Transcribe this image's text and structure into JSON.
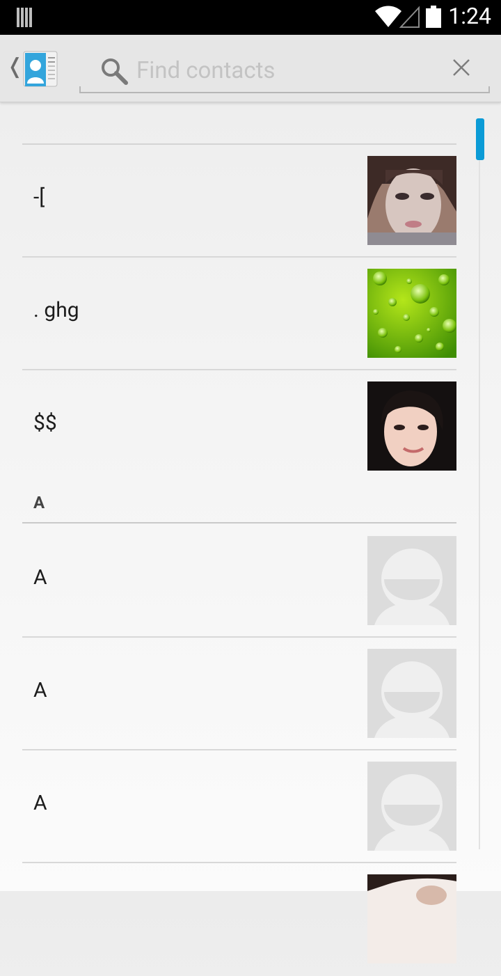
{
  "status_bar": {
    "time": "1:24"
  },
  "action_bar": {
    "search": {
      "placeholder": "Find contacts",
      "value": ""
    }
  },
  "contacts": {
    "rows": [
      {
        "name": "-[",
        "avatar": "photo-girl-1"
      },
      {
        "name": ". ghg",
        "avatar": "green-water-drops"
      },
      {
        "name": "$$",
        "avatar": "photo-girl-2"
      },
      {
        "section": "A"
      },
      {
        "name": "A",
        "avatar": "default-contact-icon"
      },
      {
        "name": "A",
        "avatar": "default-contact-icon"
      },
      {
        "name": "A",
        "avatar": "default-contact-icon"
      },
      {
        "name": "",
        "avatar": "photo-partial"
      }
    ]
  },
  "colors": {
    "scrollbar_accent": "#0b9bd6",
    "status_bar": "#000000",
    "action_bar": "#e6e6e6"
  }
}
